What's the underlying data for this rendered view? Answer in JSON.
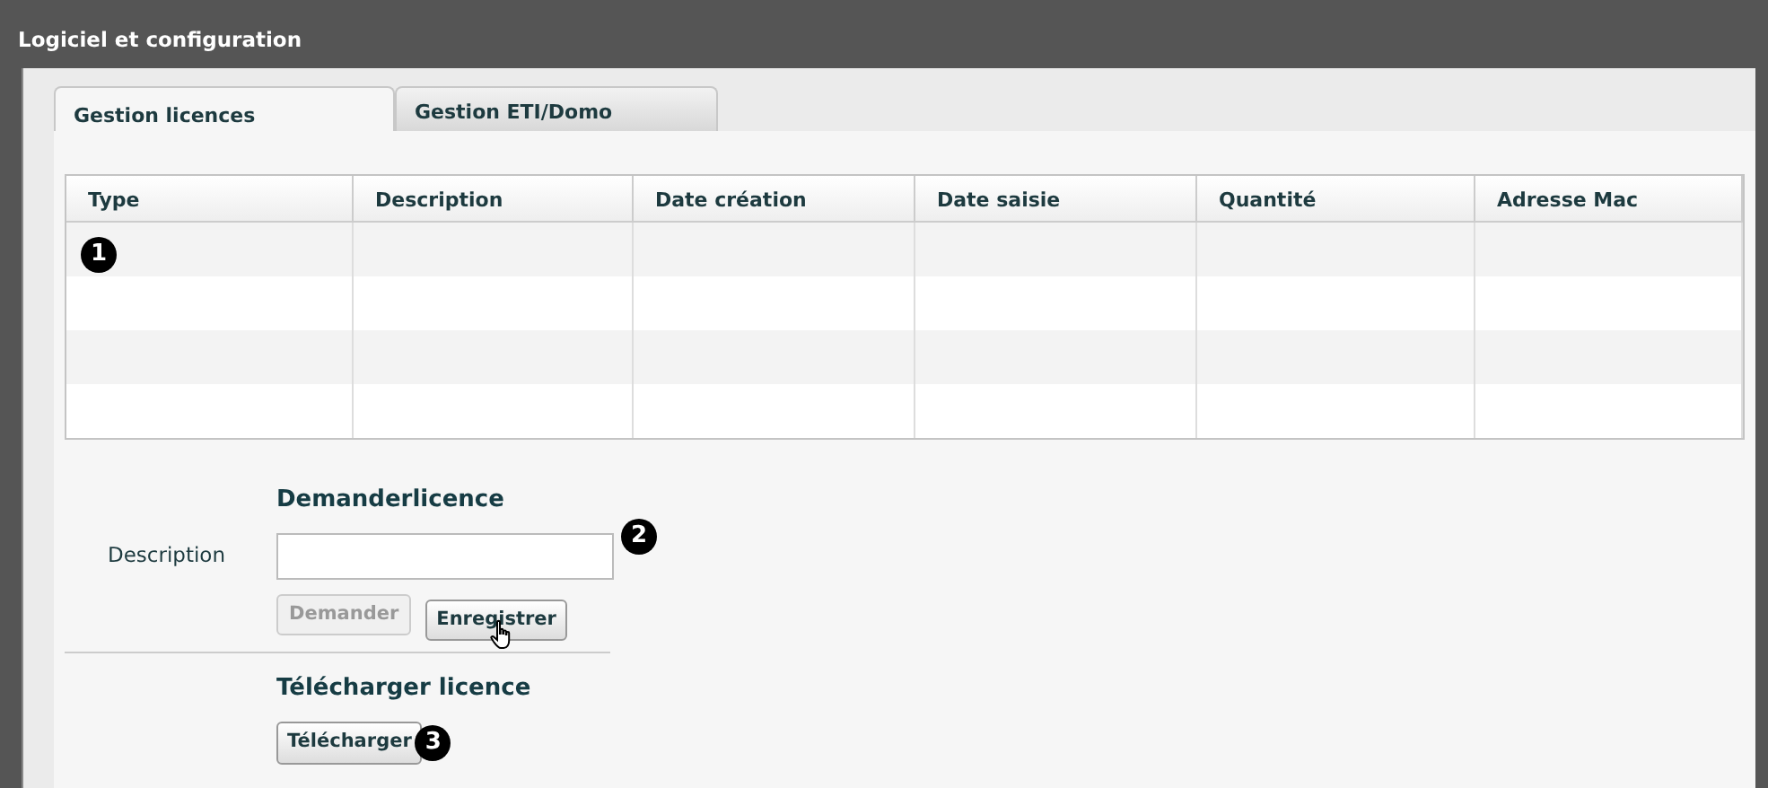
{
  "window": {
    "title": "Logiciel et configuration"
  },
  "tabs": [
    {
      "label": "Gestion licences",
      "selected": true
    },
    {
      "label": "Gestion ETI/Domo",
      "selected": false
    }
  ],
  "table": {
    "columns": [
      "Type",
      "Description",
      "Date création",
      "Date saisie",
      "Quantité",
      "Adresse Mac"
    ]
  },
  "request_form": {
    "heading": "Demanderlicence",
    "field_label": "Description",
    "buttons": [
      {
        "label": "Demander",
        "disabled": true
      },
      {
        "label": "Enregistrer",
        "disabled": false
      }
    ]
  },
  "download_form": {
    "heading": "Télécharger licence",
    "buttons": [
      {
        "label": "Télécharger",
        "disabled": false
      }
    ]
  },
  "callouts": [
    "1",
    "2",
    "3"
  ]
}
